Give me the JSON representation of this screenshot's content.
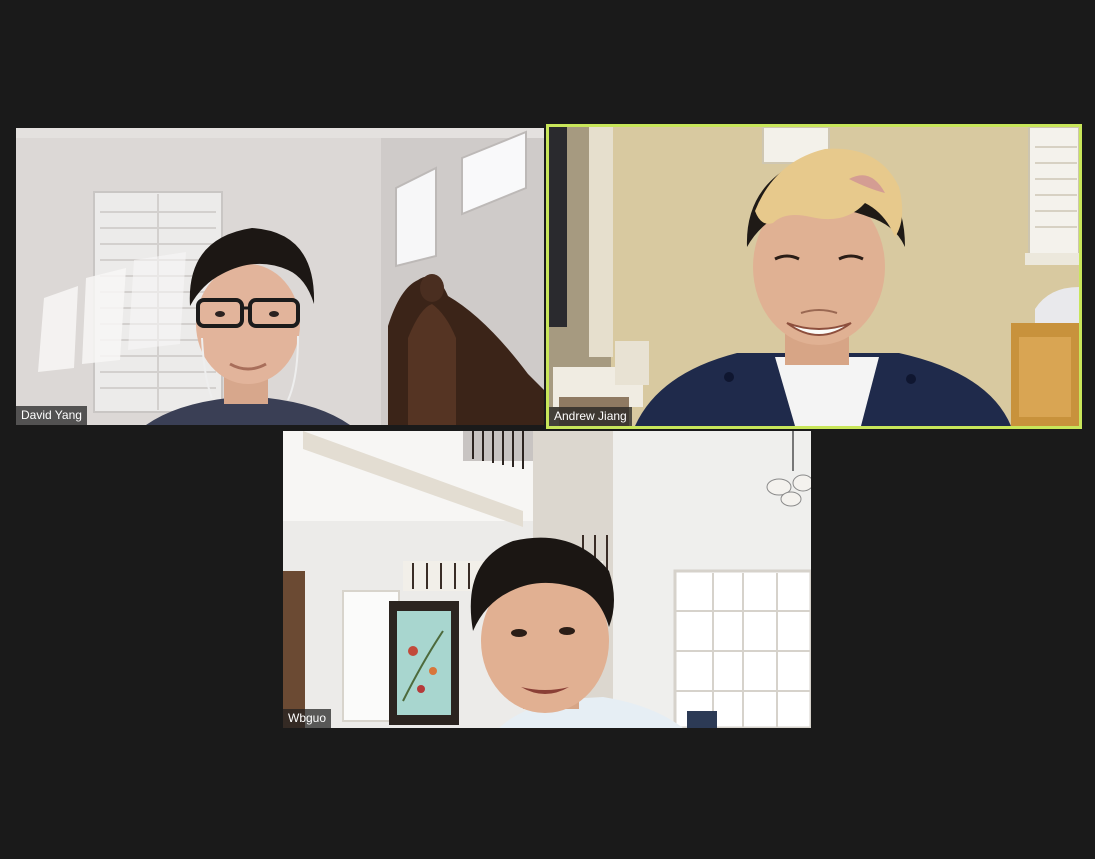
{
  "meeting": {
    "layout": "gallery-view",
    "active_speaker_color": "#c8e65a",
    "background_color": "#1a1a1a"
  },
  "participants": [
    {
      "name": "David Yang",
      "active_speaker": false
    },
    {
      "name": "Andrew Jiang",
      "active_speaker": true
    },
    {
      "name": "Wbguo",
      "active_speaker": false
    }
  ]
}
